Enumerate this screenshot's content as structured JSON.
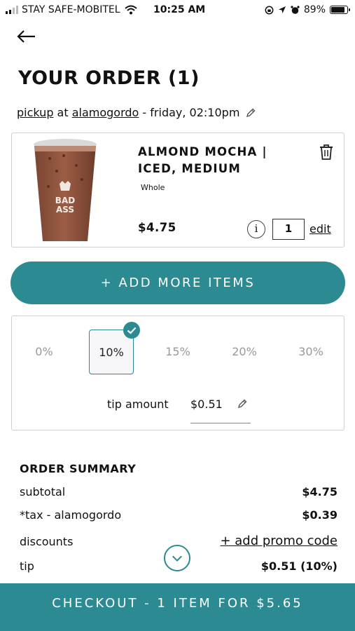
{
  "status_bar": {
    "carrier": "STAY SAFE-MOBITEL",
    "time": "10:25 AM",
    "battery_text": "89%",
    "battery_level": 0.89
  },
  "header": {
    "title": "YOUR ORDER (1)"
  },
  "pickup": {
    "mode": "pickup",
    "at": " at ",
    "location": "alamogordo",
    "when": " - friday, 02:10pm"
  },
  "item": {
    "name": "ALMOND MOCHA | ICED, MEDIUM",
    "option": "Whole",
    "price": "$4.75",
    "info_symbol": "i",
    "quantity": "1",
    "edit_label": "edit",
    "cup_logo_line1": "BAD",
    "cup_logo_line2": "ASS"
  },
  "add_more": {
    "label": "+ ADD MORE ITEMS"
  },
  "tip": {
    "options": [
      "0%",
      "10%",
      "15%",
      "20%",
      "30%"
    ],
    "selected": "10%",
    "amount_label": "tip amount",
    "amount_value": "$0.51"
  },
  "summary": {
    "title": "ORDER SUMMARY",
    "subtotal_label": "subtotal",
    "subtotal_value": "$4.75",
    "tax_label": "*tax - alamogordo",
    "tax_value": "$0.39",
    "discounts_label": "discounts",
    "promo_label": "+ add promo code",
    "tip_label": "tip",
    "tip_value": "$0.51 (10%)"
  },
  "checkout": {
    "label": "CHECKOUT - 1 ITEM FOR $5.65"
  },
  "colors": {
    "accent": "#2b8a92",
    "border": "#cfcfcf"
  }
}
